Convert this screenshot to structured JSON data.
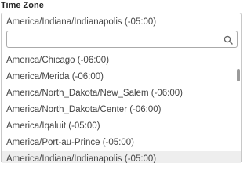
{
  "field": {
    "label": "Time Zone"
  },
  "select": {
    "selected_value": "America/Indiana/Indianapolis (-05:00)",
    "search": {
      "value": "",
      "placeholder": ""
    },
    "options": [
      {
        "label": "America/Chicago (-06:00)",
        "highlighted": false
      },
      {
        "label": "America/Merida (-06:00)",
        "highlighted": false
      },
      {
        "label": "America/North_Dakota/New_Salem (-06:00)",
        "highlighted": false
      },
      {
        "label": "America/North_Dakota/Center (-06:00)",
        "highlighted": false
      },
      {
        "label": "America/Iqaluit (-05:00)",
        "highlighted": false
      },
      {
        "label": "America/Port-au-Prince (-05:00)",
        "highlighted": false
      },
      {
        "label": "America/Indiana/Indianapolis (-05:00)",
        "highlighted": true
      }
    ]
  },
  "icons": {
    "search": "search-icon"
  },
  "colors": {
    "highlight_bg": "#eeeeee",
    "border": "#c8c8c8",
    "text": "#444444"
  }
}
